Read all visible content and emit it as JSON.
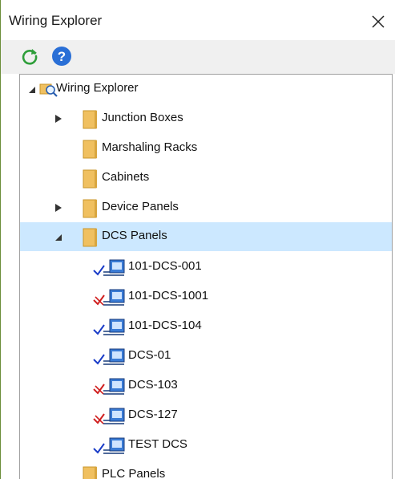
{
  "window": {
    "title": "Wiring Explorer"
  },
  "toolbar": {
    "refresh_icon": "refresh-icon",
    "help_icon": "help-icon"
  },
  "tree": {
    "root": {
      "label": "Wiring Explorer",
      "expanded": true
    },
    "groups": [
      {
        "label": "Junction Boxes",
        "has_children": true,
        "expanded": false
      },
      {
        "label": "Marshaling Racks",
        "has_children": false,
        "expanded": false
      },
      {
        "label": "Cabinets",
        "has_children": false,
        "expanded": false
      },
      {
        "label": "Device Panels",
        "has_children": true,
        "expanded": false
      },
      {
        "label": "DCS Panels",
        "has_children": true,
        "expanded": true,
        "selected": true
      },
      {
        "label": "PLC Panels",
        "has_children": false,
        "expanded": false
      }
    ],
    "dcs_panels": [
      {
        "label": "101-DCS-001",
        "status": "ok"
      },
      {
        "label": "101-DCS-1001",
        "status": "warning"
      },
      {
        "label": "101-DCS-104",
        "status": "ok"
      },
      {
        "label": "DCS-01",
        "status": "ok"
      },
      {
        "label": "DCS-103",
        "status": "warning"
      },
      {
        "label": "DCS-127",
        "status": "warning"
      },
      {
        "label": "TEST DCS",
        "status": "ok"
      }
    ]
  },
  "colors": {
    "selection": "#cce8ff",
    "folder": "#f0c060",
    "check_ok": "#1a3cc8",
    "check_warning": "#d02020",
    "refresh": "#2e9e3a",
    "help": "#2a6fd6"
  }
}
